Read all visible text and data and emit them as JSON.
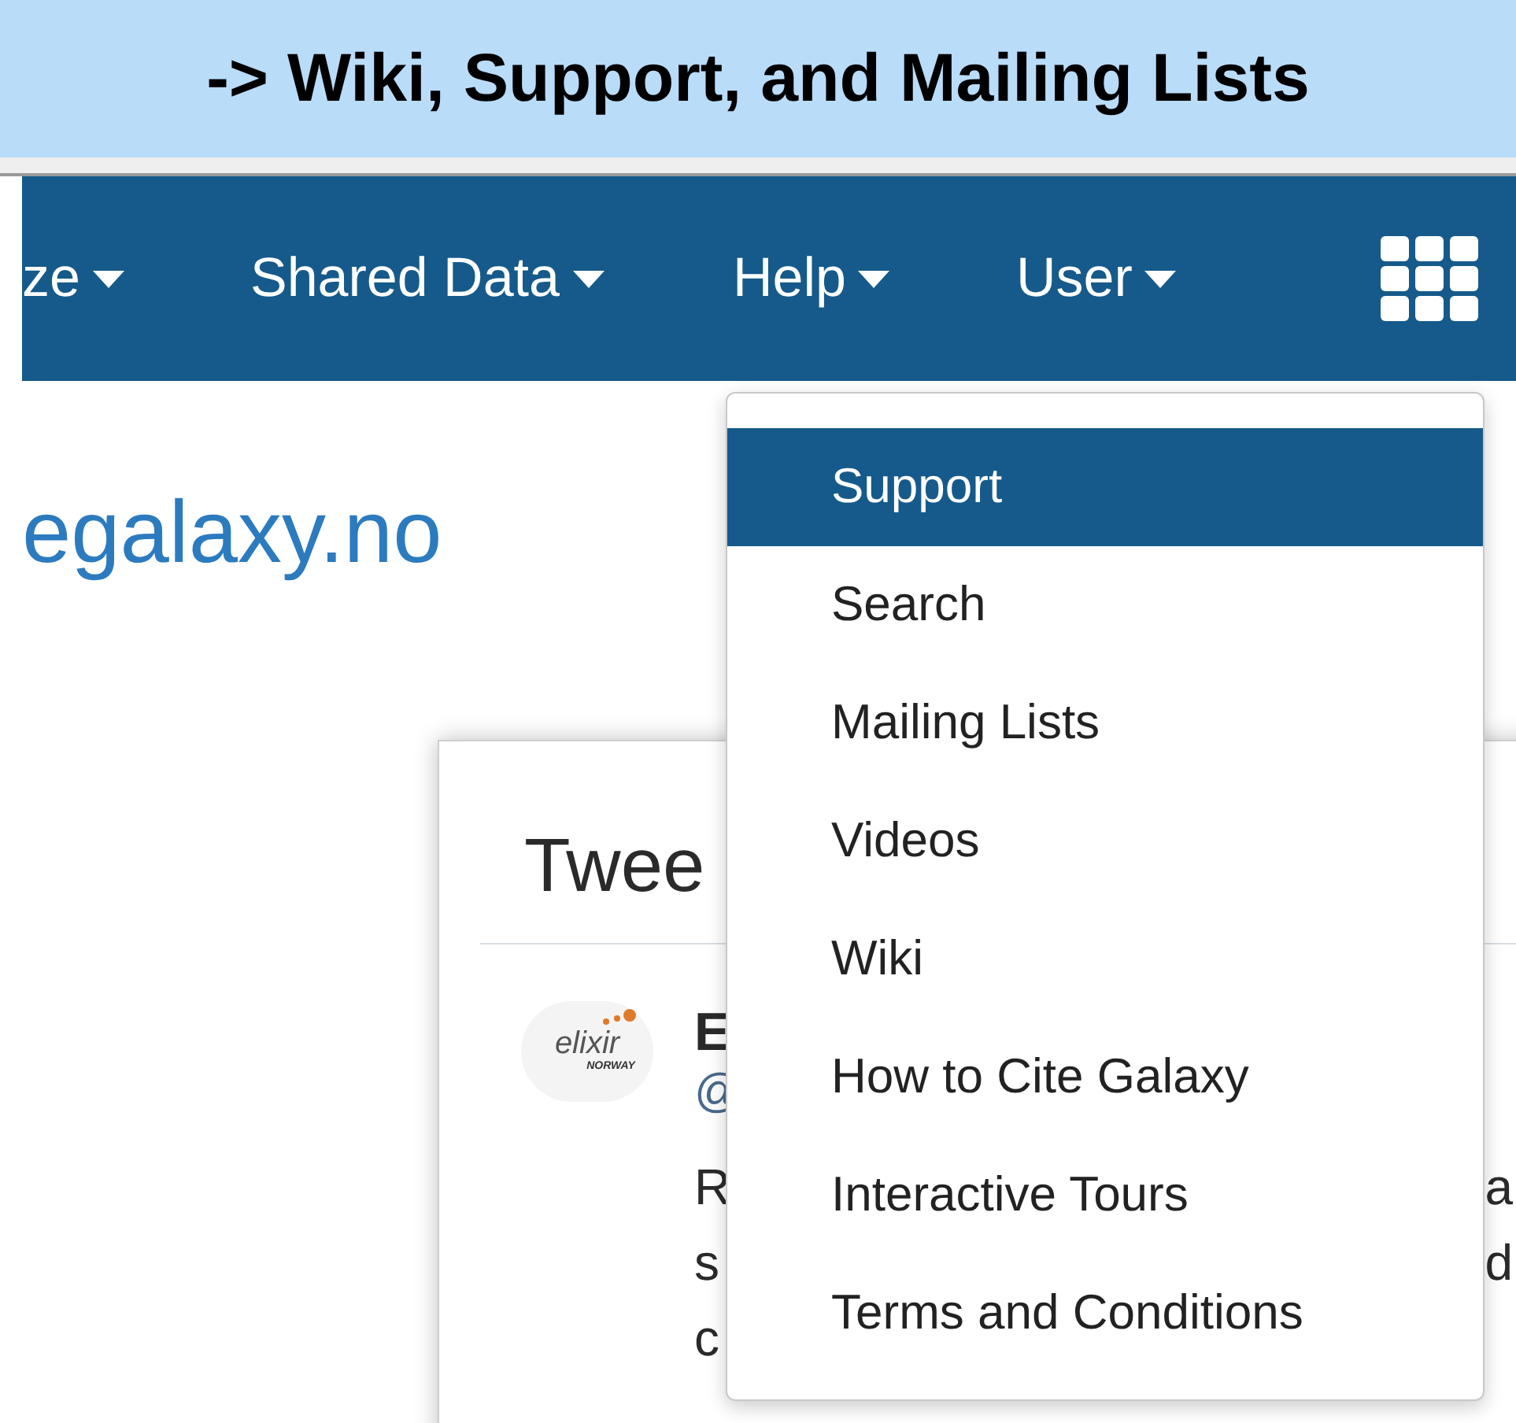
{
  "banner": {
    "title": "-> Wiki, Support, and Mailing Lists"
  },
  "navbar": {
    "items": [
      {
        "label": "ze"
      },
      {
        "label": "Shared Data"
      },
      {
        "label": "Help"
      },
      {
        "label": "User"
      }
    ]
  },
  "page": {
    "site_name": "egalaxy.no"
  },
  "tweets_card": {
    "title": "Twee",
    "logo_text": "elixir",
    "logo_subtext": "NORWAY",
    "author": "E",
    "handle": "@",
    "lines": [
      {
        "left": "R",
        "right": "a"
      },
      {
        "left": "s",
        "right": "d"
      },
      {
        "left": "c"
      }
    ]
  },
  "help_menu": {
    "items": [
      {
        "label": "Support",
        "selected": true
      },
      {
        "label": "Search",
        "selected": false
      },
      {
        "label": "Mailing Lists",
        "selected": false
      },
      {
        "label": "Videos",
        "selected": false
      },
      {
        "label": "Wiki",
        "selected": false
      },
      {
        "label": "How to Cite Galaxy",
        "selected": false
      },
      {
        "label": "Interactive Tours",
        "selected": false
      },
      {
        "label": "Terms and Conditions",
        "selected": false
      }
    ]
  }
}
